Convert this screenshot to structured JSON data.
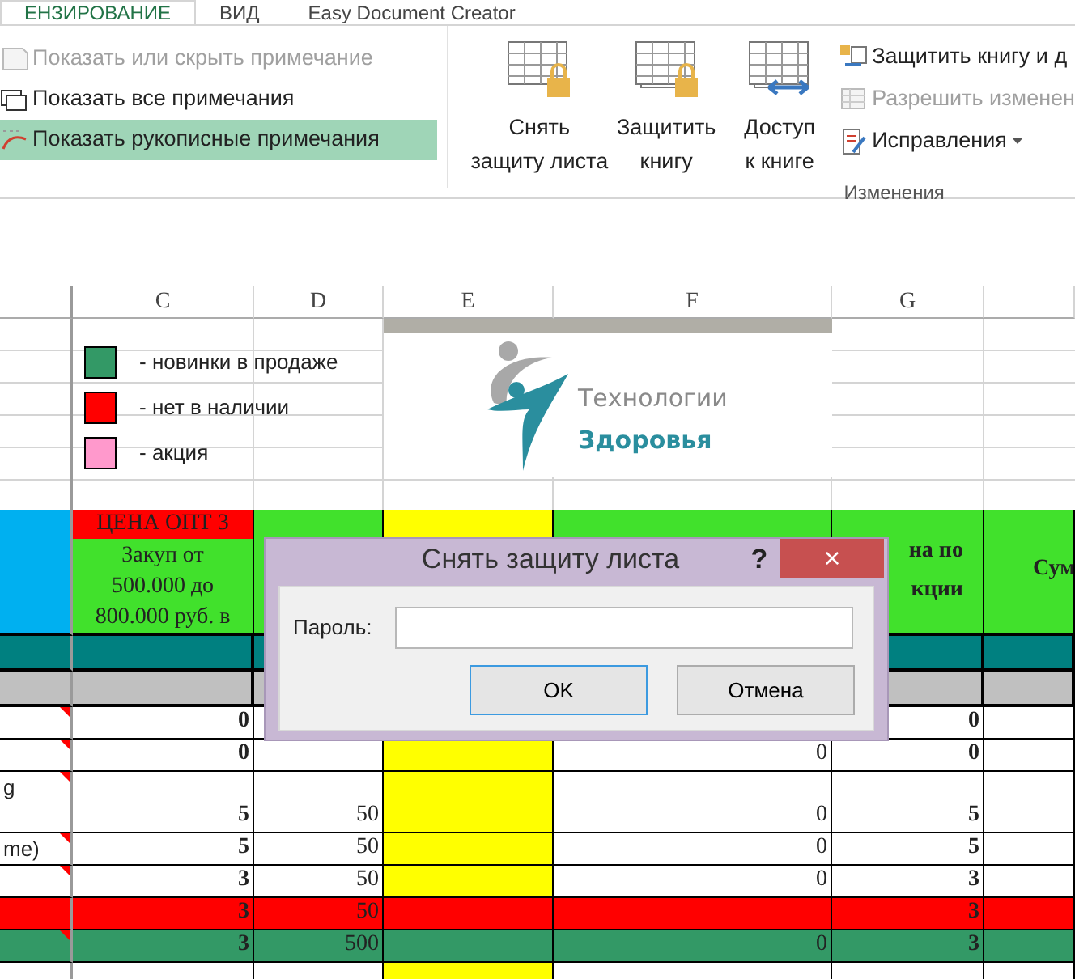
{
  "ribbon": {
    "tabs": [
      {
        "label": "ЕНЗИРОВАНИЕ",
        "selected": true
      },
      {
        "label": "ВИД",
        "selected": false
      },
      {
        "label": "Easy Document Creator",
        "selected": false
      }
    ],
    "comment_items": [
      {
        "label": "Показать или скрыть примечание",
        "disabled": true,
        "selected": false
      },
      {
        "label": "Показать все примечания",
        "disabled": false,
        "selected": false
      },
      {
        "label": "Показать рукописные примечания",
        "disabled": false,
        "selected": true
      }
    ],
    "big_buttons": [
      {
        "lines": [
          "Снять",
          "защиту листа"
        ],
        "kind": "sheet-lock"
      },
      {
        "lines": [
          "Защитить",
          "книгу"
        ],
        "kind": "book-lock"
      },
      {
        "lines": [
          "Доступ",
          "к книге"
        ],
        "kind": "share"
      }
    ],
    "small_buttons": [
      {
        "label": "Защитить книгу и д",
        "disabled": false,
        "has_menu": false,
        "kind": "protect"
      },
      {
        "label": "Разрешить изменен",
        "disabled": true,
        "has_menu": false,
        "kind": "allow"
      },
      {
        "label": "Исправления",
        "disabled": false,
        "has_menu": true,
        "kind": "track"
      }
    ],
    "group_label": "Изменения"
  },
  "sheet": {
    "column_headers": [
      "C",
      "D",
      "E",
      "F",
      "G"
    ],
    "legend": [
      {
        "color": "#339966",
        "text": "- новинки в продаже"
      },
      {
        "color": "#ff0000",
        "text": "- нет в наличии"
      },
      {
        "color": "#ff99cc",
        "text": "- акция"
      }
    ],
    "logo": {
      "line_1": "Технологии",
      "line_2": "Здоровья"
    },
    "header_row": {
      "price_title": "ЦЕНА ОПТ 3",
      "price_lines": [
        "Закуп  от",
        "500.000 до",
        "800.000 руб. в"
      ],
      "column_g": [
        "на по",
        "кции"
      ],
      "column_h": "Сум"
    },
    "rows": [
      {
        "cells": [
          "",
          "0",
          "",
          "",
          "0"
        ],
        "comment": true,
        "tall": false
      },
      {
        "cells": [
          "",
          "0",
          "",
          "0",
          "0"
        ],
        "comment": true,
        "tall": false
      },
      {
        "cells": [
          "g",
          "5",
          "50",
          "0",
          "5"
        ],
        "comment": true,
        "tall": true
      },
      {
        "cells": [
          "me)",
          "5",
          "50",
          "0",
          "5"
        ],
        "comment": true,
        "tall": false
      },
      {
        "cells": [
          "",
          "3",
          "50",
          "0",
          "3"
        ],
        "comment": true,
        "tall": false
      },
      {
        "cells": [
          "",
          "3",
          "50",
          "",
          "3"
        ],
        "comment": false,
        "tall": false,
        "color": "#ff0000"
      },
      {
        "cells": [
          "",
          "3",
          "500",
          "0",
          "3"
        ],
        "comment": true,
        "tall": false,
        "color": "#339966"
      }
    ]
  },
  "dialog": {
    "title": "Снять защиту листа",
    "help": "?",
    "close": "×",
    "field_label": "Пароль:",
    "buttons": [
      {
        "label": "OK",
        "default": true
      },
      {
        "label": "Отмена",
        "default": false
      }
    ]
  }
}
